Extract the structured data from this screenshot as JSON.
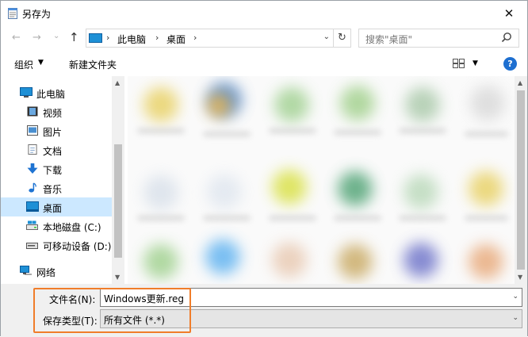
{
  "window": {
    "title": "另存为",
    "close_glyph": "✕"
  },
  "nav": {
    "back": "←",
    "forward": "→",
    "recent": "⌄",
    "up": "↑",
    "address": {
      "pc": "此电脑",
      "desktop": "桌面",
      "sep": "›"
    },
    "refresh": "↻",
    "search_placeholder": "搜索\"桌面\""
  },
  "toolbar": {
    "organize": "组织",
    "organize_dd": "▼",
    "new_folder": "新建文件夹",
    "view_dd": "▼",
    "help": "?"
  },
  "sidebar": {
    "items": [
      {
        "label": "此电脑",
        "icon": "pc-icon"
      },
      {
        "label": "视频",
        "icon": "video-icon"
      },
      {
        "label": "图片",
        "icon": "pictures-icon"
      },
      {
        "label": "文档",
        "icon": "documents-icon"
      },
      {
        "label": "下载",
        "icon": "download-icon"
      },
      {
        "label": "音乐",
        "icon": "music-icon"
      },
      {
        "label": "桌面",
        "icon": "desktop-icon"
      },
      {
        "label": "本地磁盘 (C:)",
        "icon": "local-disk-icon"
      },
      {
        "label": "可移动设备 (D:)",
        "icon": "removable-drive-icon"
      },
      {
        "label": "网络",
        "icon": "network-icon"
      }
    ],
    "selected": "桌面"
  },
  "form": {
    "filename_label": "文件名(N):",
    "filename_value": "Windows更新.reg",
    "filetype_label": "保存类型(T):",
    "filetype_value": "所有文件  (*.*)",
    "dd": "⌄"
  },
  "colors": {
    "highlight": "#f07d2a",
    "selection": "#cce8ff",
    "accent": "#1e6fd0"
  }
}
